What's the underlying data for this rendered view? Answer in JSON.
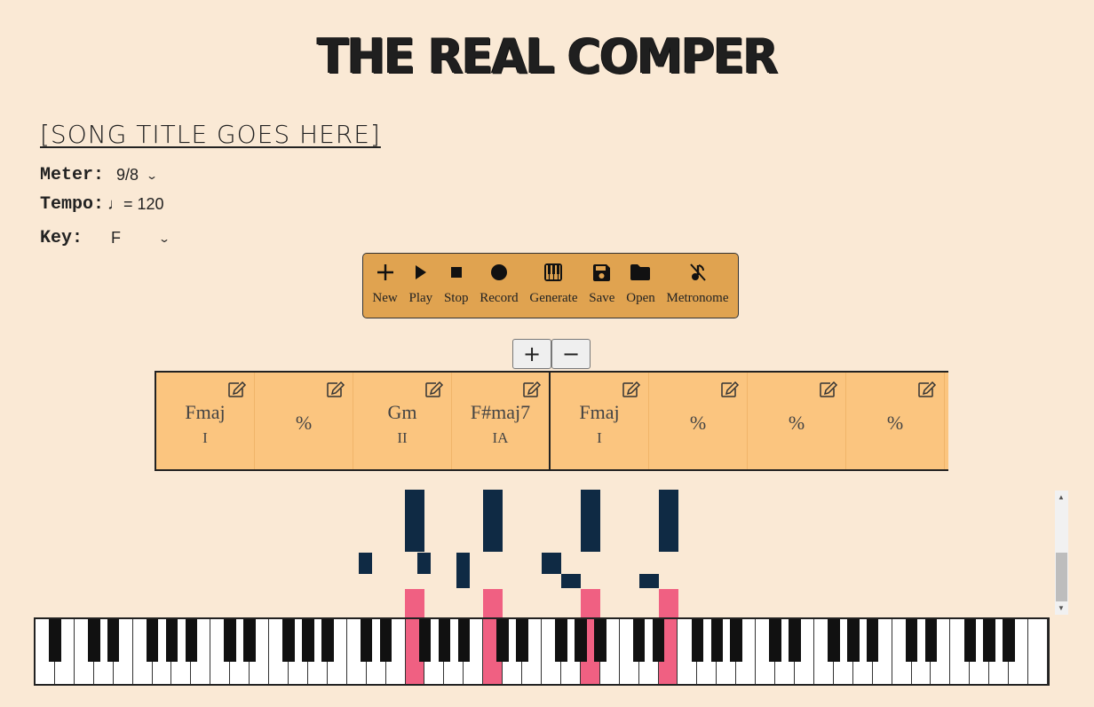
{
  "app": {
    "title": "THE REAL COMPER"
  },
  "song": {
    "title": "[SONG TITLE GOES HERE]"
  },
  "meter": {
    "label": "Meter:",
    "value": "9/8"
  },
  "tempo": {
    "label": "Tempo:",
    "note_symbol": "♩",
    "value": "= 120"
  },
  "key": {
    "label": "Key:",
    "value": "F"
  },
  "toolbar": {
    "items": [
      {
        "label": "New",
        "icon": "plus-icon"
      },
      {
        "label": "Play",
        "icon": "play-icon"
      },
      {
        "label": "Stop",
        "icon": "stop-icon"
      },
      {
        "label": "Record",
        "icon": "record-icon"
      },
      {
        "label": "Generate",
        "icon": "piano-icon"
      },
      {
        "label": "Save",
        "icon": "floppy-icon"
      },
      {
        "label": "Open",
        "icon": "folder-icon"
      },
      {
        "label": "Metronome",
        "icon": "metronome-off-icon"
      }
    ]
  },
  "zoom": {
    "plus": "+",
    "minus": "−"
  },
  "measures": [
    {
      "chord": "Fmaj",
      "roman": "I"
    },
    {
      "repeat": "%"
    },
    {
      "chord": "Gm",
      "roman": "II"
    },
    {
      "chord": "F#maj7",
      "roman": "IA"
    },
    {
      "chord": "Fmaj",
      "roman": "I"
    },
    {
      "repeat": "%"
    },
    {
      "repeat": "%"
    },
    {
      "repeat": "%"
    }
  ],
  "colors": {
    "background": "#fae9d5",
    "toolbar": "#e0a350",
    "measure_fill": "#fbc57f",
    "note": "#0f2a44",
    "pressed_key": "#f06082"
  }
}
